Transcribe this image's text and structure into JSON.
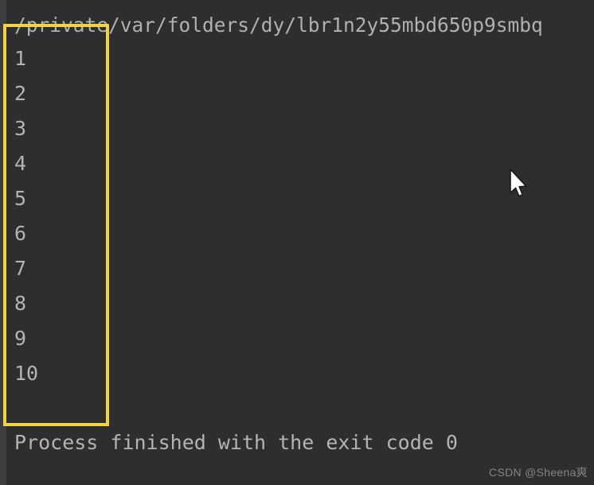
{
  "console": {
    "path_line": "/private/var/folders/dy/lbr1n2y55mbd650p9smbq",
    "output_lines": [
      "1",
      "2",
      "3",
      "4",
      "5",
      "6",
      "7",
      "8",
      "9",
      "10"
    ],
    "exit_line": "Process finished with the exit code 0",
    "background_color": "#2e2e2e",
    "text_color": "#b4b4b4",
    "gutter_color": "#3c3f41"
  },
  "annotation": {
    "type": "rectangle",
    "color": "#f5d340",
    "label": "highlight-rectangle"
  },
  "watermark": {
    "text": "CSDN @Sheena爽"
  },
  "cursor": {
    "icon": "arrow-pointer"
  }
}
